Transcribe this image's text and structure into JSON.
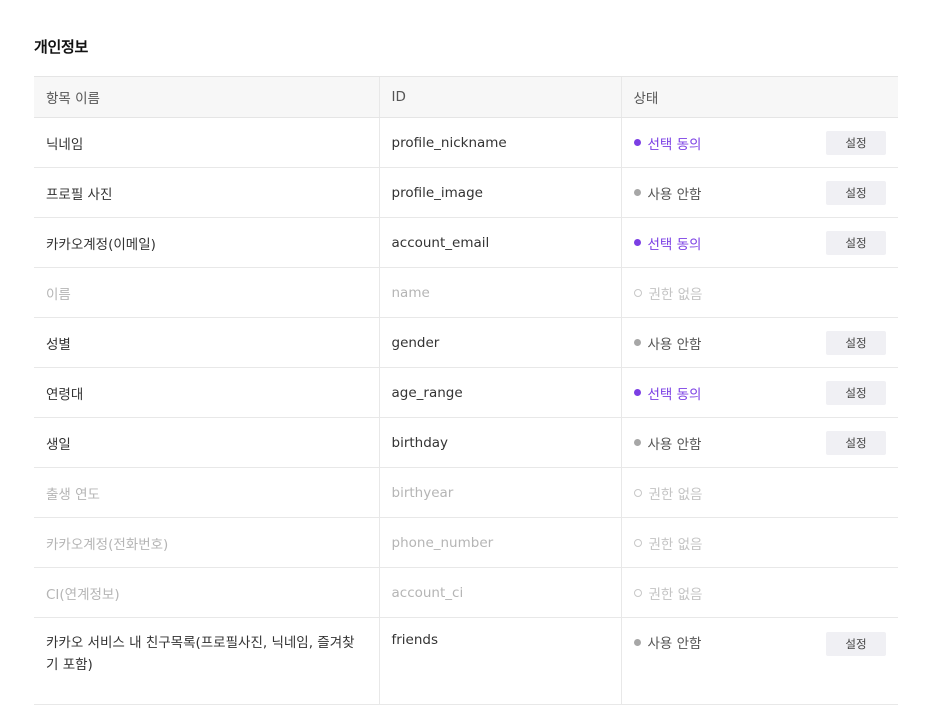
{
  "section": {
    "title": "개인정보"
  },
  "table": {
    "headers": {
      "name": "항목 이름",
      "id": "ID",
      "status": "상태"
    },
    "rows": [
      {
        "name": "닉네임",
        "id": "profile_nickname",
        "status": "선택 동의",
        "button": "설정"
      },
      {
        "name": "프로필 사진",
        "id": "profile_image",
        "status": "사용 안함",
        "button": "설정"
      },
      {
        "name": "카카오계정(이메일)",
        "id": "account_email",
        "status": "선택 동의",
        "button": "설정"
      },
      {
        "name": "이름",
        "id": "name",
        "status": "권한 없음"
      },
      {
        "name": "성별",
        "id": "gender",
        "status": "사용 안함",
        "button": "설정"
      },
      {
        "name": "연령대",
        "id": "age_range",
        "status": "선택 동의",
        "button": "설정"
      },
      {
        "name": "생일",
        "id": "birthday",
        "status": "사용 안함",
        "button": "설정"
      },
      {
        "name": "출생 연도",
        "id": "birthyear",
        "status": "권한 없음"
      },
      {
        "name": "카카오계정(전화번호)",
        "id": "phone_number",
        "status": "권한 없음"
      },
      {
        "name": "CI(연계정보)",
        "id": "account_ci",
        "status": "권한 없음"
      },
      {
        "name": "카카오 서비스 내 친구목록(프로필사진, 닉네임, 즐겨찾기 포함)",
        "id": "friends",
        "status": "사용 안함",
        "button": "설정"
      }
    ]
  },
  "colors": {
    "agree": "#7b3fe4",
    "not_used": "#a7a7a7",
    "no_permission": "#c4c4c4"
  }
}
